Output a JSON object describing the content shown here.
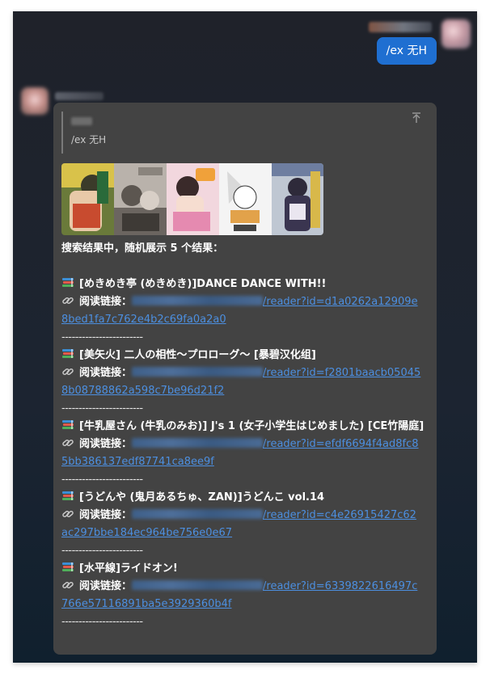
{
  "my_message": {
    "text": "/ex 无H"
  },
  "bot_message": {
    "quote": {
      "text": "/ex 无H"
    },
    "summary": "搜索结果中，随机展示 5 个结果：",
    "link_label": "阅读链接：",
    "separator": "------------------------",
    "results": [
      {
        "title": "[めきめき亭 (めきめき)]DANCE DANCE WITH!!",
        "link_path_line1": "/reader?id=d1a0262a12909e",
        "link_path_line2": "8bed1fa7c762e4b2c69fa0a2a0"
      },
      {
        "title": "[美矢火] 二人の相性～プロローグ～ [暴碧汉化组]",
        "link_path_line1": "/reader?id=f2801baacb05045",
        "link_path_line2": "8b08788862a598c7be96d21f2"
      },
      {
        "title": "[牛乳屋さん (牛乳のみお)] J's 1 (女子小学生はじめました) [CE竹陽庭]",
        "link_path_line1": "/reader?id=efdf6694f4ad8fc8",
        "link_path_line2": "5bb386137edf87741ca8ee9f"
      },
      {
        "title": "[うどんや (鬼月あるちゅ、ZAN)]うどんこ vol.14",
        "link_path_line1": "/reader?id=c4e26915427c62",
        "link_path_line2": "ac297bbe184ec964be756e0e67"
      },
      {
        "title": "[水平線]ライドオン!",
        "link_path_line1": "/reader?id=6339822616497c",
        "link_path_line2": "766e57116891ba5e3929360b4f"
      }
    ]
  },
  "icons": {
    "books": "books-emoji",
    "link": "link-emoji",
    "jump": "scroll-to-top-icon"
  },
  "colors": {
    "my_bubble": "#1f6fd1",
    "bot_bubble": "#434343",
    "link": "#4c8fe0"
  }
}
